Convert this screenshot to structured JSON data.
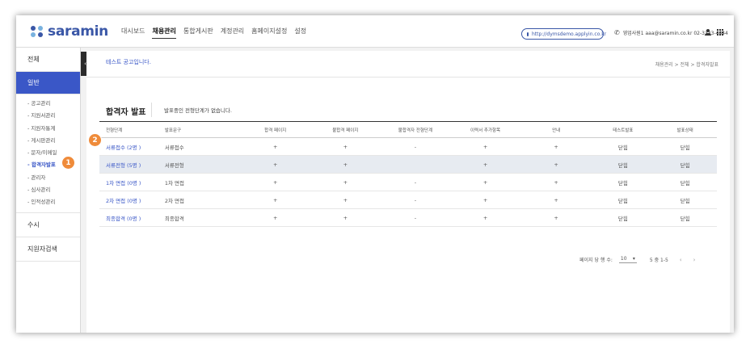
{
  "header": {
    "logo_text": "saramin",
    "logo_dot_colors": [
      "#3a57a7",
      "#79b2df",
      "#79b2df",
      "#3a57a7"
    ],
    "nav": [
      "대시보드",
      "채용관리",
      "통합게시판",
      "계정관리",
      "홈페이지설정",
      "설정"
    ],
    "active_nav": "채용관리",
    "site_url": "http://dymsdemo.applyin.co.kr",
    "user_text": "영업사원1 aaa@saramin.co.kr 02-3333-4444",
    "icons": [
      "monitor-icon",
      "phone-icon",
      "person-icon",
      "grid-menu-icon"
    ]
  },
  "sidebar": {
    "sections": [
      {
        "label": "전체"
      },
      {
        "label": "일반",
        "active": true
      }
    ],
    "sub_items": [
      {
        "label": "- 공고관리"
      },
      {
        "label": "- 지원서관리"
      },
      {
        "label": "- 지원자통계"
      },
      {
        "label": "- 게시판관리"
      },
      {
        "label": "- 문자/이메일"
      },
      {
        "label": "- 합격자발표",
        "active": true
      },
      {
        "label": "- 관리자"
      },
      {
        "label": "- 심사관리"
      },
      {
        "label": "- 인적성관리"
      }
    ],
    "bottom_sections": [
      {
        "label": "수시"
      },
      {
        "label": "지원자검색"
      }
    ],
    "collapse_glyph": "‹"
  },
  "main": {
    "posting_title": "테스트 공고입니다.",
    "breadcrumb": "채용관리  >  전체  >  합격자발표",
    "section_title": "합격자 발표",
    "section_note": "발표중인 전형단계가 없습니다.",
    "table": {
      "headers": [
        "전형단계",
        "발표문구",
        "합격 페이지",
        "불합격 페이지",
        "불합격자 전형단계",
        "이력서 추가항목",
        "안내",
        "테스트발표",
        "발표상태"
      ],
      "rows": [
        {
          "cells": [
            "서류접수 (2명 )",
            "서류접수",
            "+",
            "+",
            "-",
            "+",
            "+",
            "닫힘",
            "닫힘"
          ],
          "highlight": false
        },
        {
          "cells": [
            "서류전형 (5명 )",
            "서류전형",
            "+",
            "+",
            "",
            "+",
            "+",
            "닫힘",
            "닫힘"
          ],
          "highlight": true
        },
        {
          "cells": [
            "1차 면접 (0명 )",
            "1차 면접",
            "+",
            "+",
            "-",
            "+",
            "+",
            "닫힘",
            "닫힘"
          ],
          "highlight": false
        },
        {
          "cells": [
            "2차 면접 (0명 )",
            "2차 면접",
            "+",
            "+",
            "-",
            "+",
            "+",
            "닫힘",
            "닫힘"
          ],
          "highlight": false
        },
        {
          "cells": [
            "최종합격 (0명 )",
            "최종합격",
            "+",
            "+",
            "-",
            "+",
            "+",
            "닫힘",
            "닫힘"
          ],
          "highlight": false
        }
      ]
    },
    "pagination": {
      "per_page_label": "페이지 당 행 수:",
      "per_page_value": "10",
      "range": "5 중 1-5",
      "prev": "‹",
      "next": "›"
    }
  },
  "annotations": {
    "badge_1": "1",
    "badge_2": "2",
    "badge_color": "#ef8b3a"
  },
  "colors": {
    "accent": "#3a57c7",
    "row_highlight": "#e7ebf1"
  }
}
